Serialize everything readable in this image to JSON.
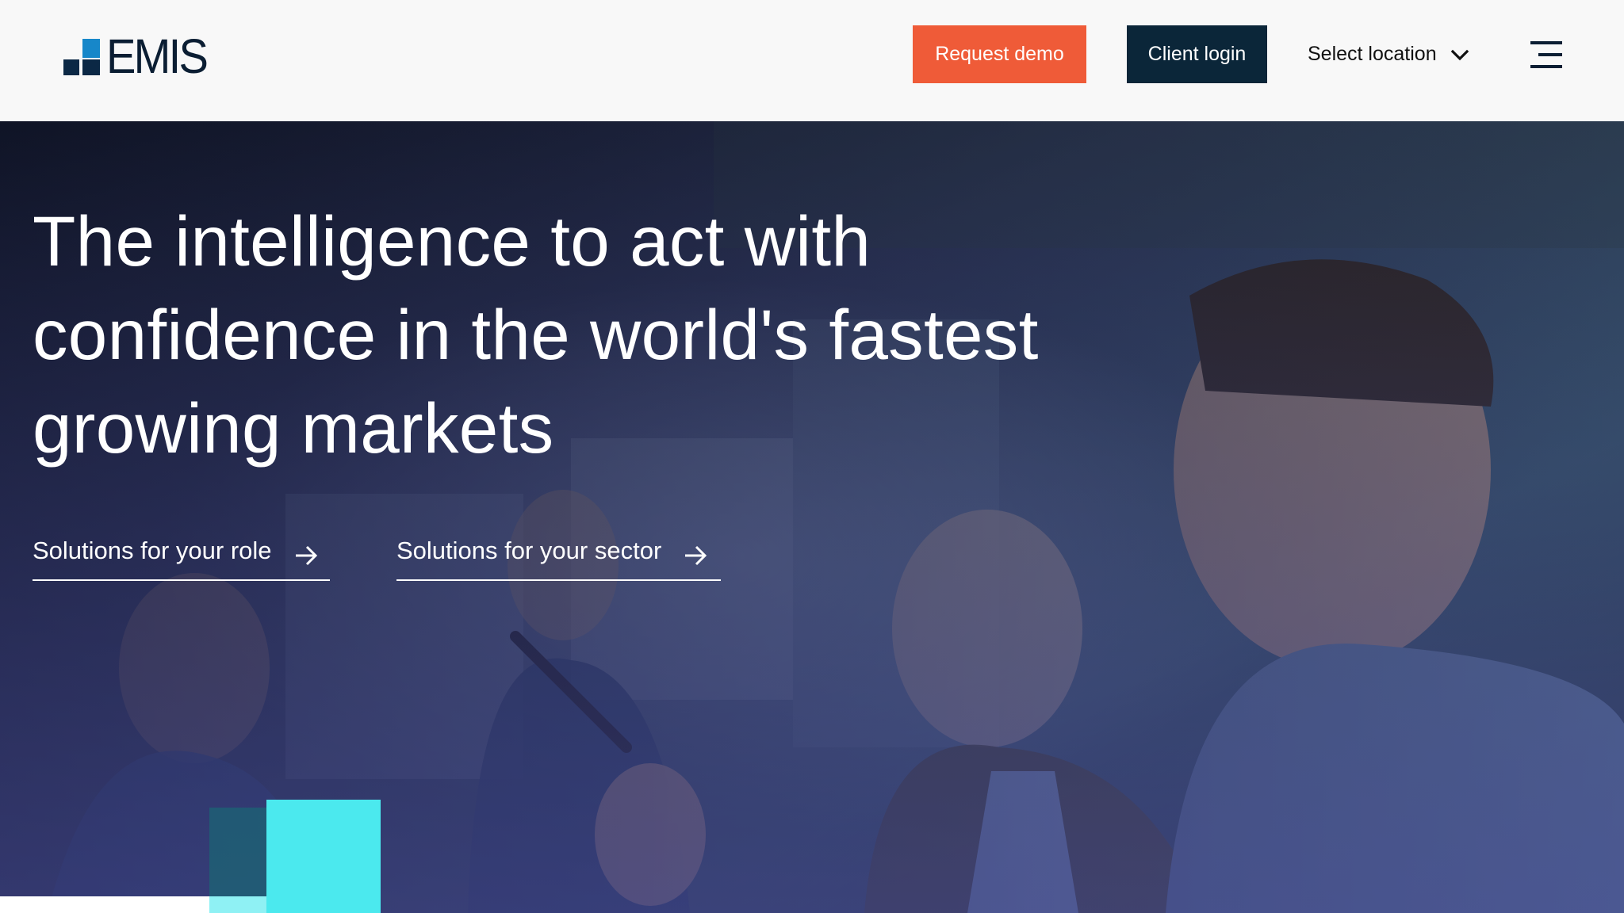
{
  "header": {
    "logo_text": "EMIS",
    "request_demo_label": "Request demo",
    "client_login_label": "Client login",
    "location_label": "Select location",
    "location_icon": "chevron-down-icon",
    "menu_icon": "hamburger-menu-icon"
  },
  "hero": {
    "title_lines": [
      "The intelligence to act with",
      "confidence in the world's fastest",
      "growing markets"
    ],
    "links": [
      {
        "label": "Solutions for your role",
        "icon": "arrow-right-icon"
      },
      {
        "label": "Solutions for your sector",
        "icon": "arrow-right-icon"
      }
    ]
  },
  "colors": {
    "request_demo_bg": "#ef5b38",
    "client_login_bg": "#0b2639",
    "logo_dark": "#0b2845",
    "logo_blue": "#1787c9",
    "accent_cyan": "#4be9ee",
    "header_bg": "#f8f8f8"
  }
}
